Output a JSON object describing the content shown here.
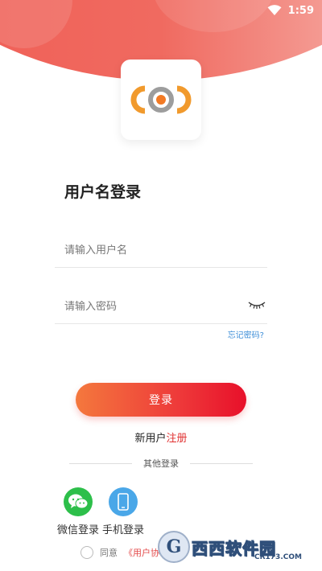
{
  "status_bar": {
    "time": "1:59"
  },
  "title": "用户名登录",
  "username": {
    "placeholder": "请输入用户名",
    "value": ""
  },
  "password": {
    "placeholder": "请输入密码",
    "value": ""
  },
  "forgot_password": "忘记密码?",
  "login_button": "登录",
  "register": {
    "prefix": "新用户",
    "link": "注册"
  },
  "other_login": "其他登录",
  "social": [
    {
      "label": "微信登录",
      "icon": "wechat-icon",
      "color": "#2dbf4a"
    },
    {
      "label": "手机登录",
      "icon": "phone-icon",
      "color": "#4aa7e8"
    }
  ],
  "agreement": {
    "prefix": "同意",
    "link": "《用户协议"
  },
  "watermark": {
    "brand": "西西软件园",
    "site": "CR173.COM"
  },
  "colors": {
    "header": "#ef5a52",
    "button_start": "#f4783d",
    "button_end": "#e8102a",
    "link_blue": "#3f8fd8",
    "accent_red": "#e03030"
  }
}
